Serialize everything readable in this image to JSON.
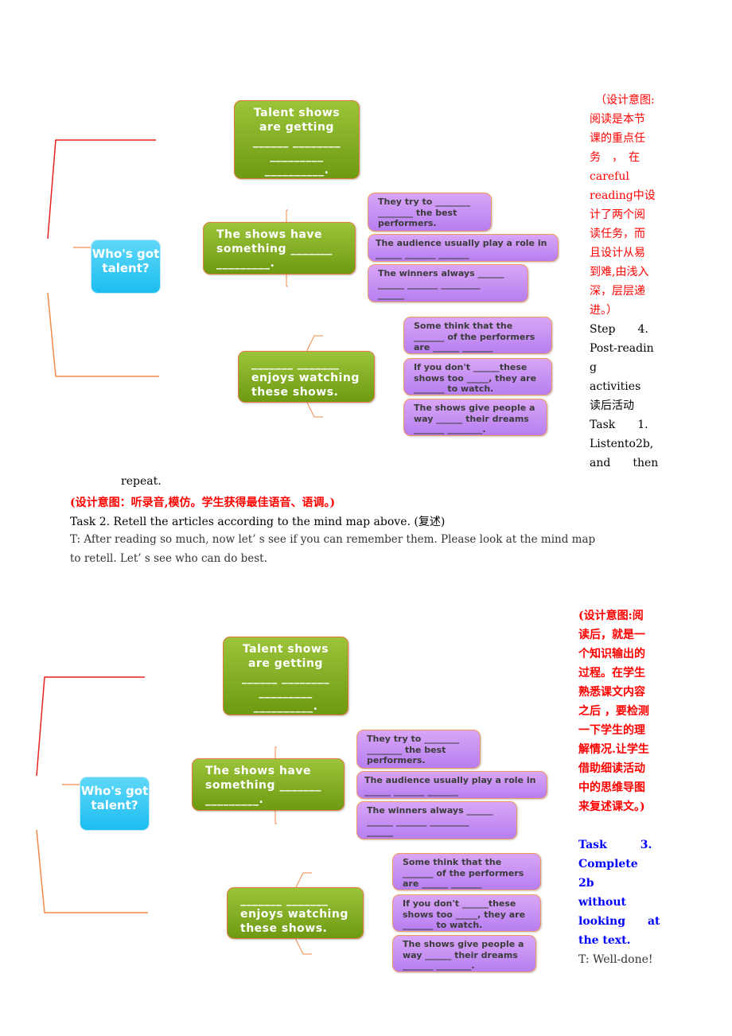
{
  "mindmap": {
    "root": "Who's got talent?",
    "branch1": [
      "Talent shows",
      "are getting",
      "______ ________",
      "_________",
      "__________."
    ],
    "branch2": [
      "The shows have",
      "something _______",
      "_________."
    ],
    "branch2_children": [
      [
        "They try to ________",
        "________ the best",
        "performers."
      ],
      [
        "The audience usually play a role in",
        "______ _______ _______"
      ],
      [
        "The winners always ______",
        "______ _______ _________",
        "______"
      ]
    ],
    "branch3": [
      "_______ _______",
      "enjoys watching",
      "these shows."
    ],
    "branch3_children": [
      [
        "Some think that the",
        "_______ of the performers",
        "are ______ _______"
      ],
      [
        "If you don't ______these",
        "shows too _____, they are",
        "_______ to watch."
      ],
      [
        "The shows give people a",
        "way ______ their dreams",
        "_______ ________."
      ]
    ]
  },
  "side1": {
    "red_lines": [
      "（设计意图:",
      "阅读是本节",
      "课的重点任",
      "务　，　在",
      "careful",
      "reading中设",
      "计了两个阅",
      "读任务，而",
      "且设计从易",
      "到难,由浅入",
      "深，层层递",
      "进。）"
    ],
    "black_lines": [
      "Step　　4.",
      "Post-readin",
      "g",
      "activities",
      "读后活动",
      "Task　　1.",
      "Listento2b,",
      "and　　then"
    ]
  },
  "body": {
    "repeat": "repeat.",
    "design_note": "(设计意图：听录音,模仿。学生获得最佳语音、语调。)",
    "task2": "Task 2. Retell the articles according to the mind map above. (复述)",
    "teacher_line1": "T: After reading so much, now let’ s see if you can remember them. Please look at the mind map",
    "teacher_line2": "to retell. Let’ s see who can do best."
  },
  "side2": {
    "red_lines": [
      "(设计意图:阅",
      "读后，就是一",
      "个知识输出的",
      "过程。在学生",
      "熟悉课文内容",
      "之后 ，要检测",
      "一下学生的理",
      "解情况.让学生",
      "借助细读活动",
      "中的思维导图",
      "来复述课文。)"
    ],
    "blue_lines": [
      "Task　　　3.",
      "Complete　2b",
      "without",
      "looking　　at",
      "the text."
    ],
    "teacher": "T: Well-done!"
  }
}
